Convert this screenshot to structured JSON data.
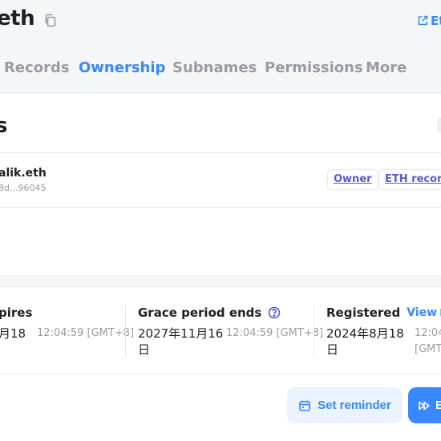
{
  "header": {
    "title": "eth",
    "external_link": "Et"
  },
  "tabs": [
    {
      "label": "Records",
      "active": false
    },
    {
      "label": "Ownership",
      "active": true
    },
    {
      "label": "Subnames",
      "active": false
    },
    {
      "label": "Permissions",
      "active": false
    },
    {
      "label": "More",
      "active": false
    }
  ],
  "ownership": {
    "section_title": "s",
    "owner": {
      "name": "alik.eth",
      "address": "8d...96045",
      "roles": [
        "Owner",
        "ETH record"
      ]
    }
  },
  "dates": {
    "expires": {
      "label": "pires",
      "date": "月18",
      "time": "12:04:59\n[GMT+8]"
    },
    "grace": {
      "label": "Grace period ends",
      "date": "2027年11月16\n日",
      "time": "12:04:59\n[GMT+8]"
    },
    "registered": {
      "label": "Registered",
      "view_label": "View",
      "date": "2024年8月18\n日",
      "time": "12:04\n[GMT"
    }
  },
  "actions": {
    "reminder_label": "Set reminder",
    "extend_label": "E"
  },
  "colors": {
    "accent": "#3888ff",
    "role_text": "#5a5ad4",
    "muted": "#9b9ba6"
  }
}
